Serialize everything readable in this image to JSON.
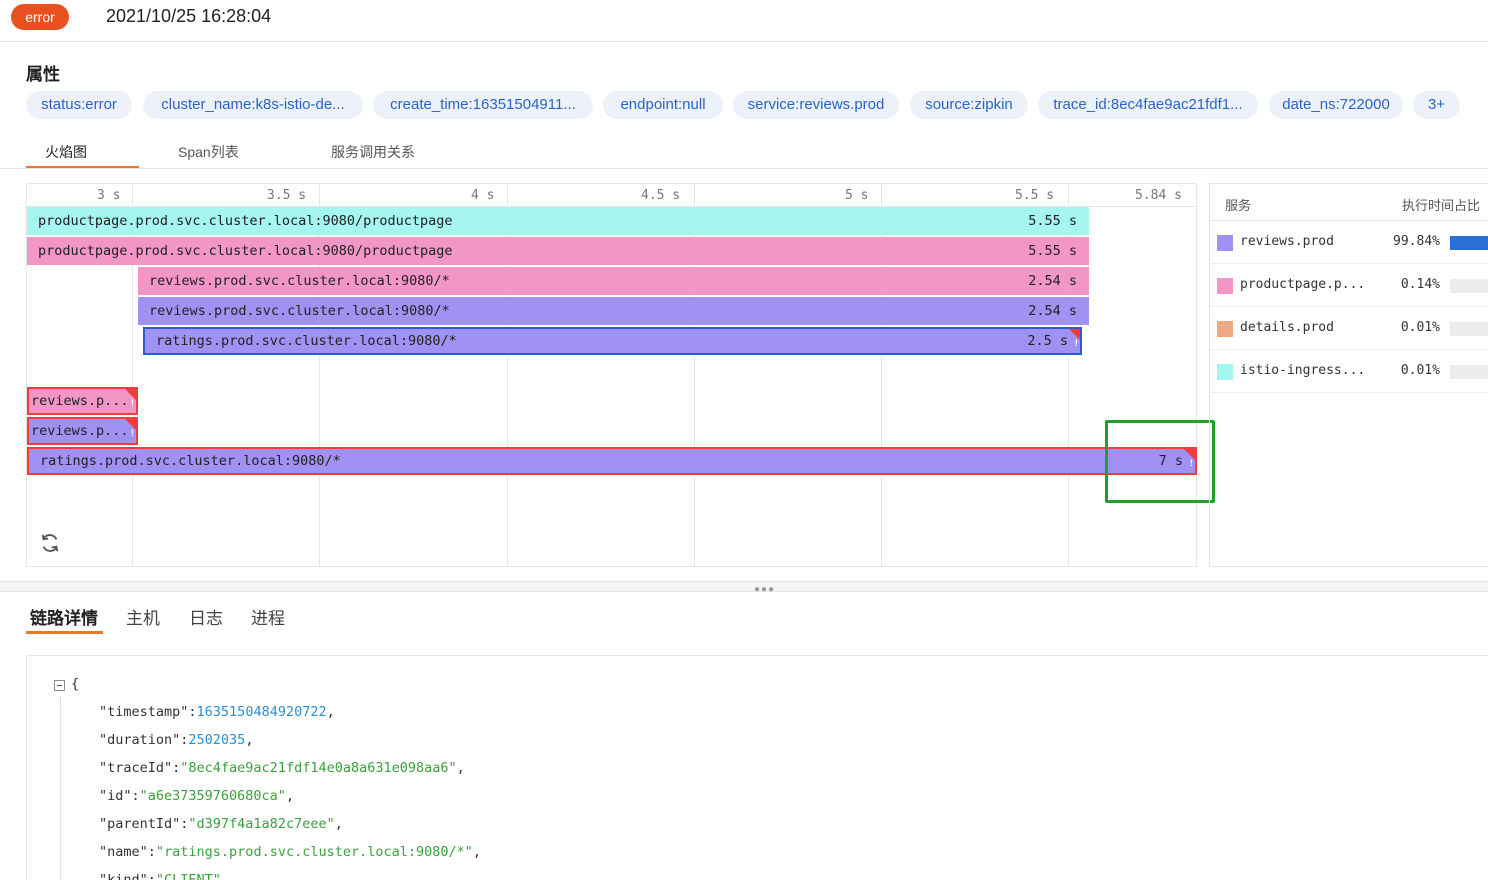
{
  "header": {
    "status_badge": "error",
    "timestamp": "2021/10/25 16:28:04"
  },
  "attributes": {
    "title": "属性",
    "tags": [
      "status:error",
      "cluster_name:k8s-istio-de...",
      "create_time:16351504911...",
      "endpoint:null",
      "service:reviews.prod",
      "source:zipkin",
      "trace_id:8ec4fae9ac21fdf1...",
      "date_ns:722000",
      "3+"
    ]
  },
  "view_tabs": {
    "items": [
      "火焰图",
      "Span列表",
      "服务调用关系"
    ],
    "active": "火焰图"
  },
  "flame_graph": {
    "ticks": [
      "3 s",
      "3.5 s",
      "4 s",
      "4.5 s",
      "5 s",
      "5.5 s",
      "5.84 s"
    ],
    "spans": [
      {
        "label": "productpage.prod.svc.cluster.local:9080/productpage",
        "duration": "5.55 s",
        "color": "#a4f6ee",
        "error": false
      },
      {
        "label": "productpage.prod.svc.cluster.local:9080/productpage",
        "duration": "5.55 s",
        "color": "#f196c6",
        "error": false
      },
      {
        "label": "reviews.prod.svc.cluster.local:9080/*",
        "duration": "2.54 s",
        "color": "#f196c6",
        "error": false
      },
      {
        "label": "reviews.prod.svc.cluster.local:9080/*",
        "duration": "2.54 s",
        "color": "#a092f2",
        "error": false
      },
      {
        "label": "ratings.prod.svc.cluster.local:9080/*",
        "duration": "2.5 s",
        "color": "#a092f2",
        "error": true
      },
      {
        "label": "reviews.p...",
        "duration": "",
        "color": "#f196c6",
        "error": true
      },
      {
        "label": "reviews.p...",
        "duration": "",
        "color": "#a092f2",
        "error": true
      },
      {
        "label": "ratings.prod.svc.cluster.local:9080/*",
        "duration": "7 s",
        "color": "#a092f2",
        "error": true
      }
    ],
    "error_mark": "!"
  },
  "service_panel": {
    "col_service": "服务",
    "col_ratio": "执行时间占比",
    "rows": [
      {
        "name": "reviews.prod",
        "percent": "99.84%",
        "ratio": 0.9984,
        "color": "#a092f2"
      },
      {
        "name": "productpage.p...",
        "percent": "0.14%",
        "ratio": 0.0014,
        "color": "#f196c6"
      },
      {
        "name": "details.prod",
        "percent": "0.01%",
        "ratio": 0.0001,
        "color": "#f0a882"
      },
      {
        "name": "istio-ingress...",
        "percent": "0.01%",
        "ratio": 0.0001,
        "color": "#a4f6ee"
      }
    ]
  },
  "detail_tabs": {
    "items": [
      "链路详情",
      "主机",
      "日志",
      "进程"
    ],
    "active": "链路详情"
  },
  "json_view": {
    "open_brace": "{",
    "lines": [
      {
        "key": "\"timestamp\":",
        "value": "1635150484920722",
        "type": "number",
        "tail": ","
      },
      {
        "key": "\"duration\":",
        "value": "2502035",
        "type": "number",
        "tail": ","
      },
      {
        "key": "\"traceId\":",
        "value": "\"8ec4fae9ac21fdf14e0a8a631e098aa6\"",
        "type": "string",
        "tail": ","
      },
      {
        "key": "\"id\":",
        "value": "\"a6e37359760680ca\"",
        "type": "string",
        "tail": ","
      },
      {
        "key": "\"parentId\":",
        "value": "\"d397f4a1a82c7eee\"",
        "type": "string",
        "tail": ","
      },
      {
        "key": "\"name\":",
        "value": "\"ratings.prod.svc.cluster.local:9080/*\"",
        "type": "string",
        "tail": ","
      },
      {
        "key": "\"kind\":",
        "value": "\"CLIENT\"",
        "type": "string",
        "tail": ","
      }
    ]
  }
}
